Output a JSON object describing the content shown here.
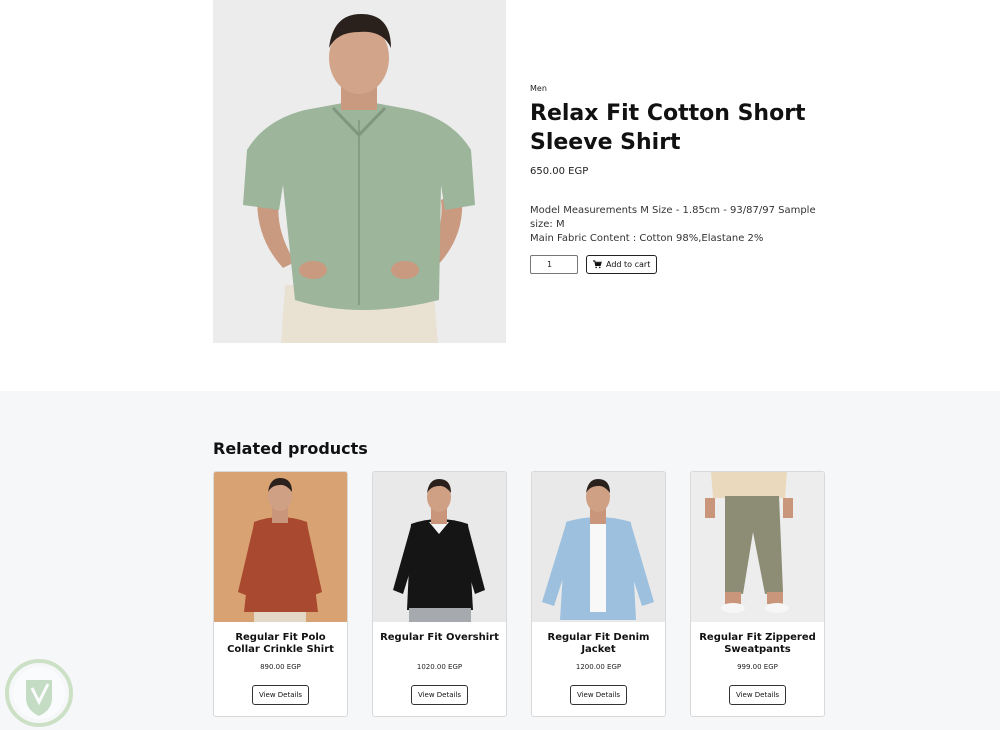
{
  "product": {
    "category": "Men",
    "title": "Relax Fit Cotton Short Sleeve Shirt",
    "price": "650.00 EGP",
    "description_line1": "Model Measurements M Size - 1.85cm - 93/87/97 Sample size: M",
    "description_line2": "Main Fabric Content : Cotton 98%,Elastane 2%",
    "quantity": "1",
    "add_to_cart_label": "Add to cart",
    "image_icon": "product-photo-green-shirt"
  },
  "related": {
    "heading": "Related products",
    "items": [
      {
        "name": "Regular Fit Polo Collar Crinkle Shirt",
        "price": "890.00 EGP",
        "button": "View Details",
        "bg": "#d9a272",
        "garment": "#a9492f"
      },
      {
        "name": "Regular Fit Overshirt",
        "price": "1020.00 EGP",
        "button": "View Details",
        "bg": "#e9e9e9",
        "garment": "#151515"
      },
      {
        "name": "Regular Fit Denim Jacket",
        "price": "1200.00 EGP",
        "button": "View Details",
        "bg": "#e9e9e9",
        "garment": "#9cc0de"
      },
      {
        "name": "Regular Fit Zippered Sweatpants",
        "price": "999.00 EGP",
        "button": "View Details",
        "bg": "#ededed",
        "garment": "#8d8c75"
      }
    ]
  },
  "colors": {
    "shirt_green": "#9cb59b",
    "related_bg": "#f6f7f9"
  }
}
